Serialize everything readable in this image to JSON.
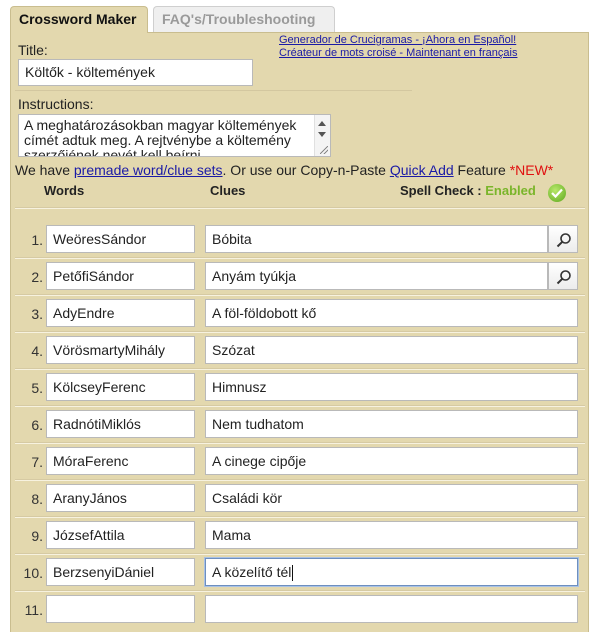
{
  "tabs": {
    "active": "Crossword Maker",
    "inactive": "FAQ's/Troubleshooting"
  },
  "links": {
    "spanish": "Generador de Crucigramas - ¡Ahora en Español!",
    "french": "Créateur de mots croisé - Maintenant en français"
  },
  "form": {
    "title_label": "Title:",
    "title_value": "Költők - költemények",
    "instructions_label": "Instructions:",
    "instructions_value": "A meghatározásokban magyar költemények címét adtuk meg. A rejtvénybe a költemény szerzőjének nevét kell beírni."
  },
  "premade": {
    "prefix": "We have ",
    "link1": "premade word/clue sets",
    "middle": ". Or use our Copy-n-Paste ",
    "link2": "Quick Add",
    "suffix": " Feature ",
    "new_label": "*NEW*"
  },
  "table": {
    "words_header": "Words",
    "clues_header": "Clues",
    "spell_check_label": "Spell Check :",
    "spell_check_status": "Enabled",
    "rows": [
      {
        "num": "1.",
        "word": "WeöresSándor",
        "clue": "Bóbita"
      },
      {
        "num": "2.",
        "word": "PetőfiSándor",
        "clue": "Anyám tyúkja"
      },
      {
        "num": "3.",
        "word": "AdyEndre",
        "clue": "A föl-földobott kő"
      },
      {
        "num": "4.",
        "word": "VörösmartyMihály",
        "clue": "Szózat"
      },
      {
        "num": "5.",
        "word": "KölcseyFerenc",
        "clue": "Himnusz"
      },
      {
        "num": "6.",
        "word": "RadnótiMiklós",
        "clue": "Nem tudhatom"
      },
      {
        "num": "7.",
        "word": "MóraFerenc",
        "clue": "A cinege cipője"
      },
      {
        "num": "8.",
        "word": "AranyJános",
        "clue": "Családi kör"
      },
      {
        "num": "9.",
        "word": "JózsefAttila",
        "clue": "Mama"
      },
      {
        "num": "10.",
        "word": "BerzsenyiDániel",
        "clue": "A közelítő tél"
      },
      {
        "num": "11.",
        "word": "",
        "clue": ""
      }
    ]
  },
  "colors": {
    "panel_bg": "#e3d8ae",
    "link": "#1a1aa6",
    "new_red": "#e01010",
    "enabled_green": "#7ab52a"
  }
}
